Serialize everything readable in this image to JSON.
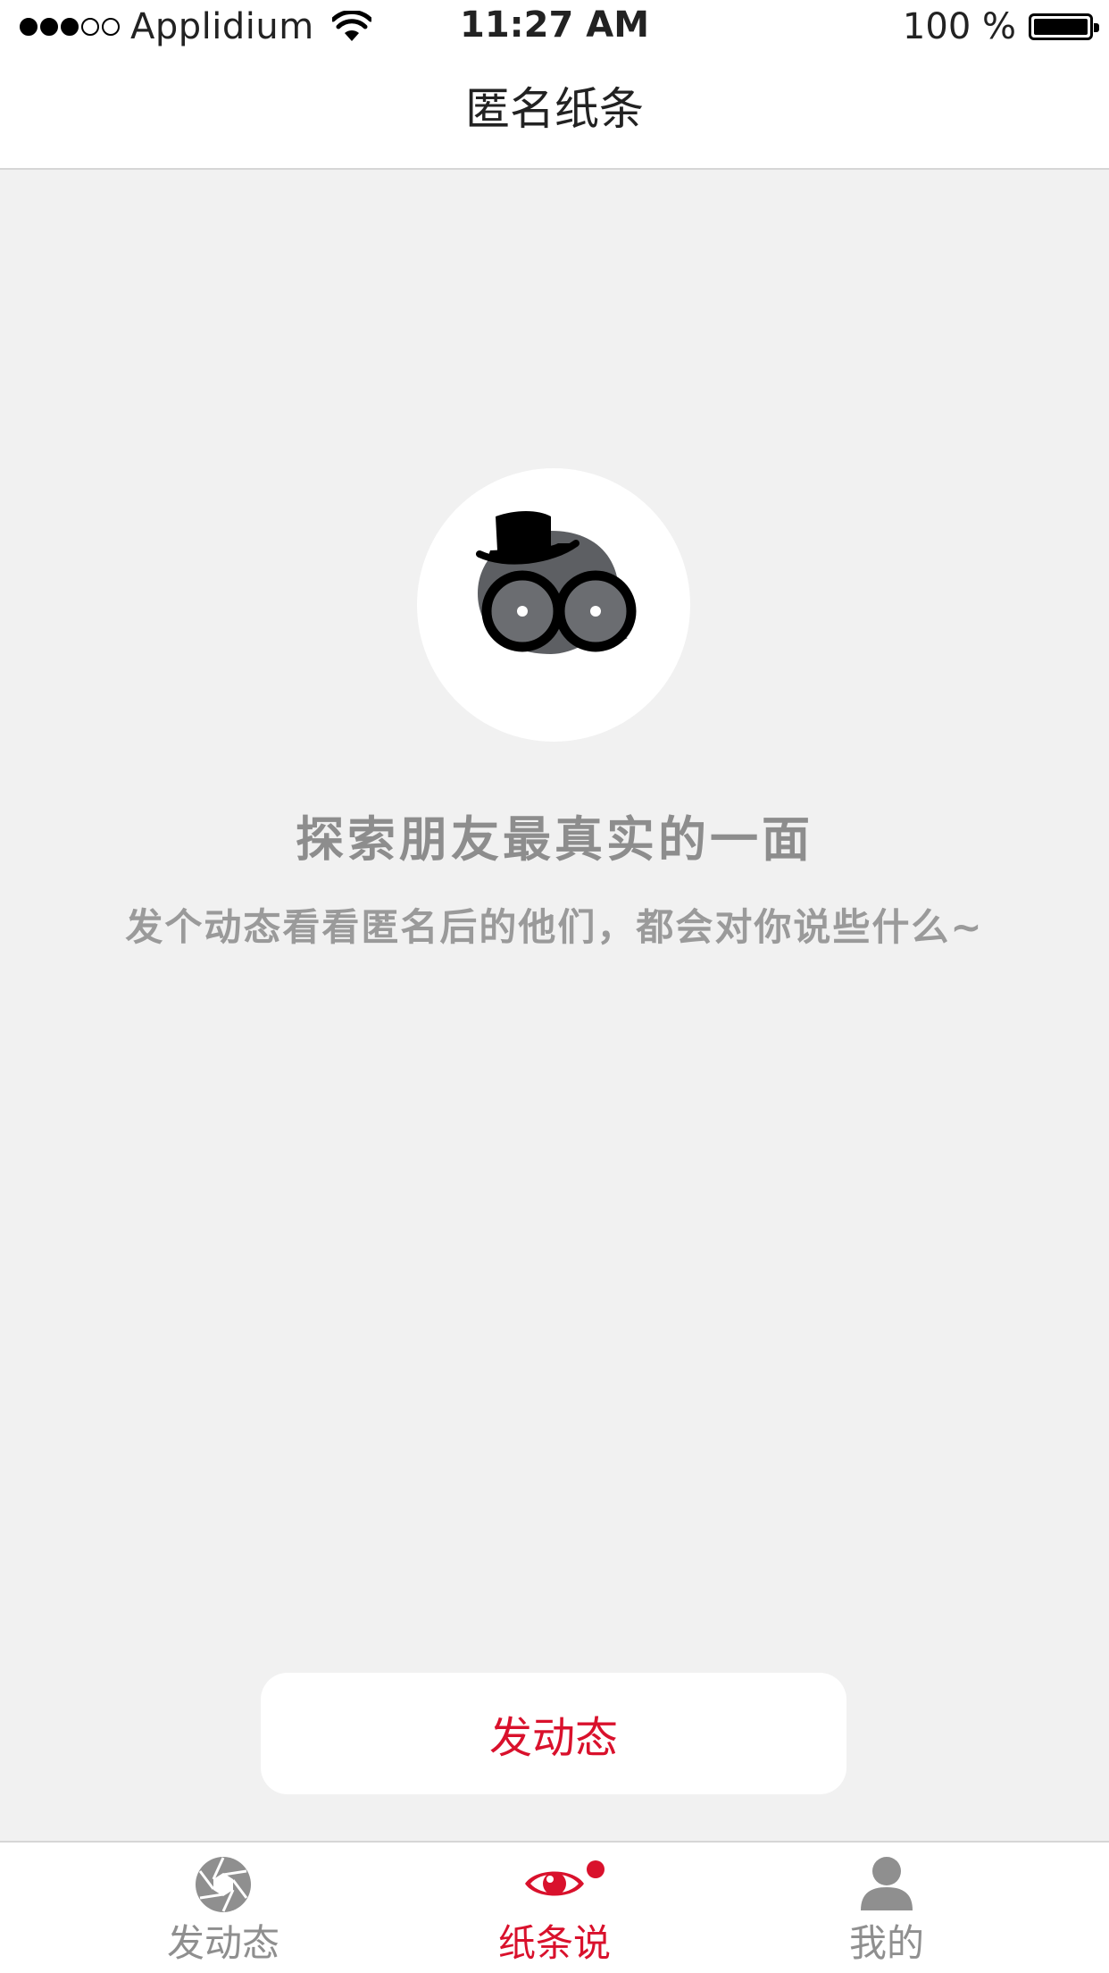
{
  "status_bar": {
    "carrier": "Applidium",
    "time": "11:27 AM",
    "battery": "100 %",
    "signal_bars_filled": 3,
    "signal_bars_total": 5
  },
  "nav": {
    "title": "匿名纸条"
  },
  "main": {
    "headline": "探索朋友最真实的一面",
    "subline": "发个动态看看匿名后的他们，都会对你说些什么~",
    "post_button_label": "发动态"
  },
  "tabs": [
    {
      "label": "发动态",
      "icon": "aperture-icon",
      "active": false
    },
    {
      "label": "纸条说",
      "icon": "eye-icon",
      "active": true,
      "badge": true
    },
    {
      "label": "我的",
      "icon": "person-icon",
      "active": false
    }
  ],
  "colors": {
    "accent": "#d9112c",
    "background": "#f1f1f1",
    "inactive": "#8f8f8f",
    "mascot": "#5d5f63"
  }
}
